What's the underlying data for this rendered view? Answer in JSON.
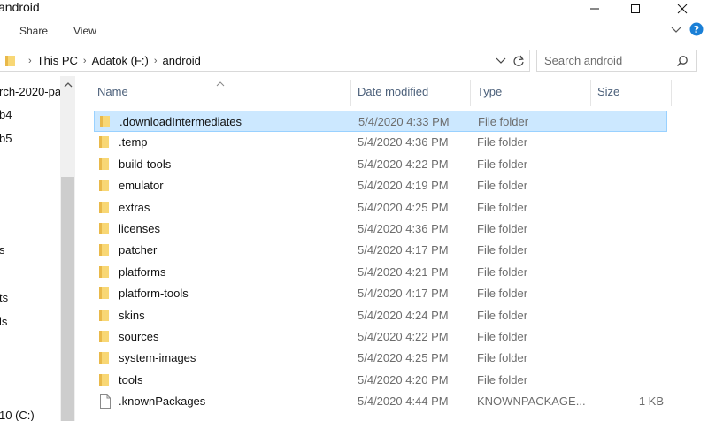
{
  "window": {
    "title": "android"
  },
  "ribbon": {
    "tabs": [
      "Share",
      "View"
    ]
  },
  "address": {
    "segments": [
      "This PC",
      "Adatok (F:)",
      "android"
    ]
  },
  "search": {
    "placeholder": "Search android"
  },
  "nav_pane": {
    "items": [
      "rch-2020-pa",
      "b4",
      "b5",
      "s",
      "ts",
      "ls",
      "10 (C:)"
    ]
  },
  "columns": {
    "name": "Name",
    "date": "Date modified",
    "type": "Type",
    "size": "Size"
  },
  "files": [
    {
      "name": ".downloadIntermediates",
      "date": "5/4/2020 4:33 PM",
      "type": "File folder",
      "size": "",
      "kind": "folder",
      "selected": true
    },
    {
      "name": ".temp",
      "date": "5/4/2020 4:36 PM",
      "type": "File folder",
      "size": "",
      "kind": "folder"
    },
    {
      "name": "build-tools",
      "date": "5/4/2020 4:22 PM",
      "type": "File folder",
      "size": "",
      "kind": "folder"
    },
    {
      "name": "emulator",
      "date": "5/4/2020 4:19 PM",
      "type": "File folder",
      "size": "",
      "kind": "folder"
    },
    {
      "name": "extras",
      "date": "5/4/2020 4:25 PM",
      "type": "File folder",
      "size": "",
      "kind": "folder"
    },
    {
      "name": "licenses",
      "date": "5/4/2020 4:36 PM",
      "type": "File folder",
      "size": "",
      "kind": "folder"
    },
    {
      "name": "patcher",
      "date": "5/4/2020 4:17 PM",
      "type": "File folder",
      "size": "",
      "kind": "folder"
    },
    {
      "name": "platforms",
      "date": "5/4/2020 4:21 PM",
      "type": "File folder",
      "size": "",
      "kind": "folder"
    },
    {
      "name": "platform-tools",
      "date": "5/4/2020 4:17 PM",
      "type": "File folder",
      "size": "",
      "kind": "folder"
    },
    {
      "name": "skins",
      "date": "5/4/2020 4:24 PM",
      "type": "File folder",
      "size": "",
      "kind": "folder"
    },
    {
      "name": "sources",
      "date": "5/4/2020 4:22 PM",
      "type": "File folder",
      "size": "",
      "kind": "folder"
    },
    {
      "name": "system-images",
      "date": "5/4/2020 4:25 PM",
      "type": "File folder",
      "size": "",
      "kind": "folder"
    },
    {
      "name": "tools",
      "date": "5/4/2020 4:20 PM",
      "type": "File folder",
      "size": "",
      "kind": "folder"
    },
    {
      "name": ".knownPackages",
      "date": "5/4/2020 4:44 PM",
      "type": "KNOWNPACKAGE...",
      "size": "1 KB",
      "kind": "file"
    }
  ],
  "colors": {
    "selection_bg": "#cce8ff",
    "selection_border": "#99d1ff",
    "folder": "#f8d775",
    "header_text": "#4c607a",
    "help_blue": "#1a7fd6"
  },
  "icons": {
    "minimize": "minimize-icon",
    "maximize": "maximize-icon",
    "close": "close-icon",
    "help": "help-icon",
    "folder": "folder-icon",
    "file": "file-icon",
    "search": "search-icon",
    "refresh": "refresh-icon"
  }
}
